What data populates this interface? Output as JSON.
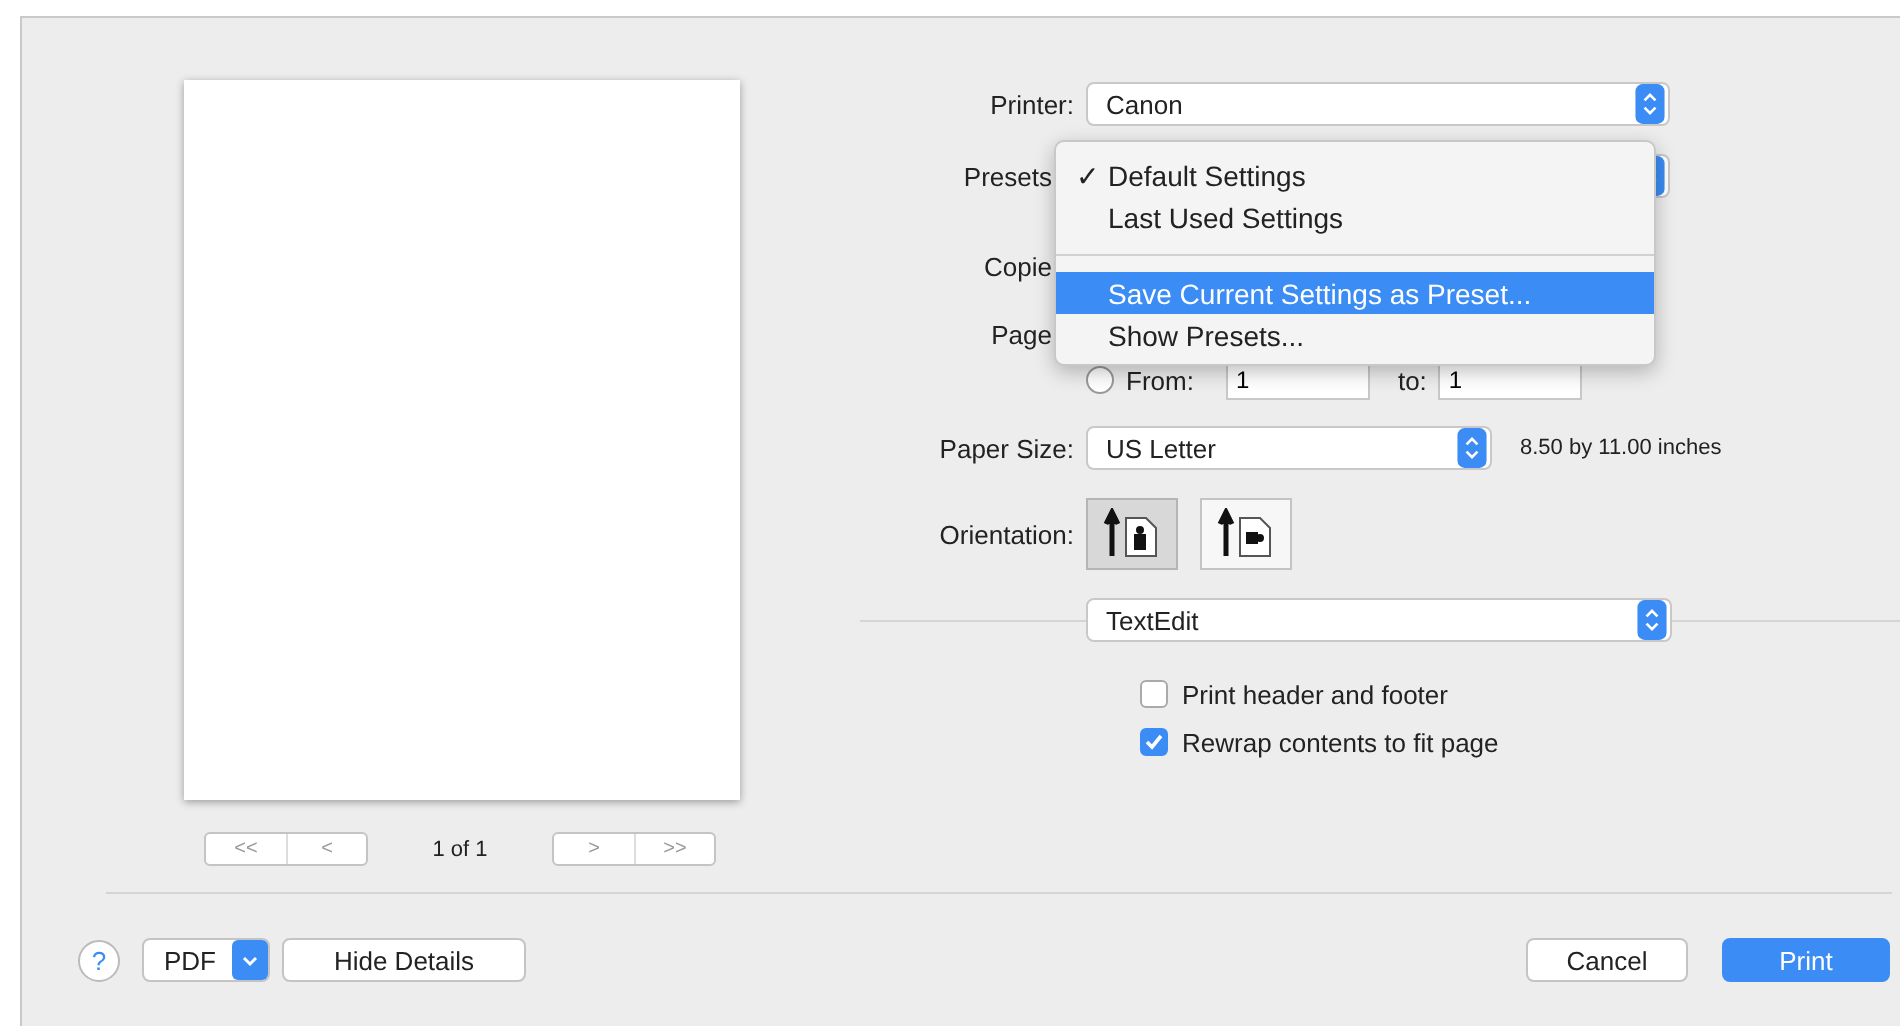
{
  "preview": {
    "page_count": "1 of 1",
    "nav_first": "<<",
    "nav_prev": "<",
    "nav_next": ">",
    "nav_last": ">>"
  },
  "printer": {
    "label": "Printer:",
    "value": "Canon"
  },
  "presets": {
    "label": "Presets"
  },
  "copies": {
    "label": "Copie"
  },
  "pages": {
    "label": "Page",
    "from_selected": false,
    "from_label": "From:",
    "from_value": "1",
    "to_label": "to:",
    "to_value": "1"
  },
  "paper_size": {
    "label": "Paper Size:",
    "value": "US Letter",
    "dimensions": "8.50 by 11.00 inches"
  },
  "orientation": {
    "label": "Orientation:",
    "options": [
      {
        "kind": "portrait",
        "selected": true
      },
      {
        "kind": "landscape",
        "selected": false
      }
    ]
  },
  "app_section": {
    "value": "TextEdit"
  },
  "options": [
    {
      "label": "Print header and footer",
      "checked": false
    },
    {
      "label": "Rewrap contents to fit page",
      "checked": true
    }
  ],
  "presets_menu": {
    "items": [
      {
        "kind": "item",
        "mark": "✓",
        "label": "Default Settings",
        "selected": false
      },
      {
        "kind": "item",
        "label": "Last Used Settings",
        "selected": false
      },
      {
        "kind": "separator"
      },
      {
        "kind": "item",
        "label": "Save Current Settings as Preset...",
        "selected": true
      },
      {
        "kind": "item",
        "label": "Show Presets...",
        "selected": false
      }
    ]
  },
  "footer": {
    "help": "?",
    "pdf": "PDF",
    "hide_details": "Hide Details",
    "cancel": "Cancel",
    "print": "Print"
  }
}
